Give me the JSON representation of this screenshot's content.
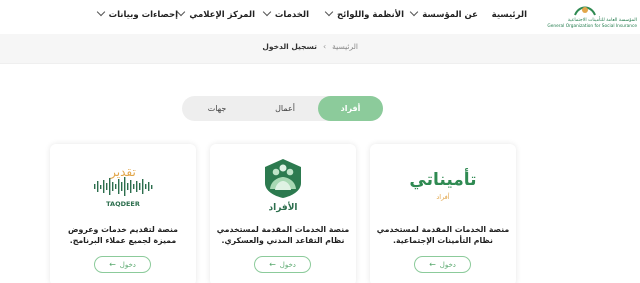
{
  "logo": {
    "line1": "المؤسسة العامة للتأمينات الاجتماعية",
    "line2": "General Organization for Social Insurance"
  },
  "nav": {
    "home": "الرئيسية",
    "about": "عن المؤسسة",
    "regulations": "الأنظمة واللوائح",
    "services": "الخدمات",
    "media": "المركز الإعلامي",
    "stats": "إحصاءات وبيانات"
  },
  "breadcrumb": {
    "home": "الرئيسية",
    "separator": "›",
    "current": "تسجيل الدخول"
  },
  "tabs": [
    {
      "label": "أفراد",
      "active": true
    },
    {
      "label": "أعمال",
      "active": false
    },
    {
      "label": "جهات",
      "active": false
    }
  ],
  "cards": [
    {
      "brand": "تأميناتي",
      "brand_sub": "أفراد",
      "description": "منصة الخدمات المقدمة لمستخدمي نظام التأمينات الإجتماعية.",
      "button": "دخول"
    },
    {
      "brand": "الأفراد",
      "description": "منصة الخدمات المقدمة لمستخدمي نظام التقاعد المدني والعسكري.",
      "button": "دخول"
    },
    {
      "brand": "تقدير",
      "brand_en": "TAQDEER",
      "description": "منصة لتقديم خدمات وعروض مميزة لجميع عملاء البرنامج.",
      "button": "دخول"
    }
  ],
  "colors": {
    "accent": "#8ccb9b",
    "brand_green": "#2f8a52",
    "dark_green": "#2c6e4d",
    "gold": "#e2a64a"
  }
}
